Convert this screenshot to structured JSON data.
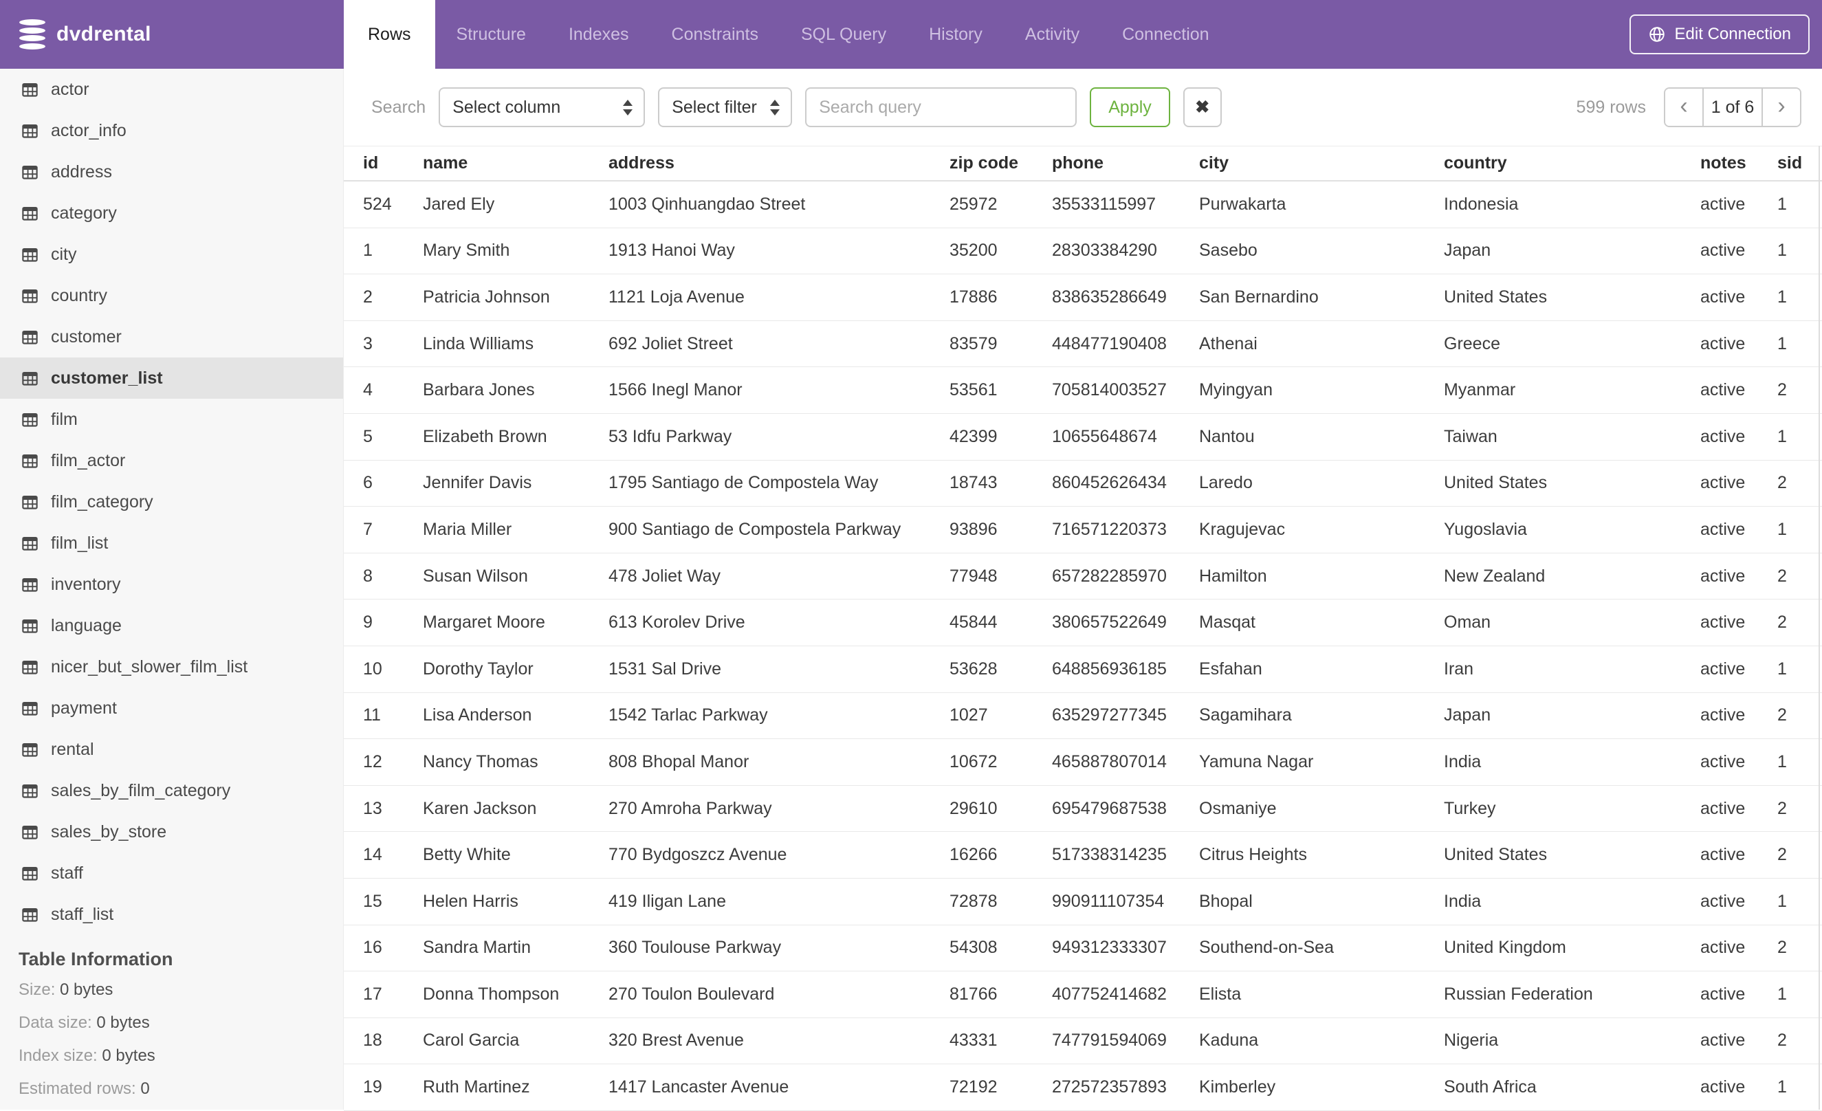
{
  "colors": {
    "header_purple": "#7a5aa5",
    "inactive_tab_text": "#cfc0e2",
    "apply_green": "#6db33f",
    "sidebar_bg": "#f7f7f7",
    "sidebar_selected_bg": "#e4e4e4"
  },
  "header": {
    "database_name": "dvdrental",
    "edit_connection_label": "Edit Connection"
  },
  "tabs": {
    "items": [
      {
        "label": "Rows",
        "active": true
      },
      {
        "label": "Structure",
        "active": false
      },
      {
        "label": "Indexes",
        "active": false
      },
      {
        "label": "Constraints",
        "active": false
      },
      {
        "label": "SQL Query",
        "active": false
      },
      {
        "label": "History",
        "active": false
      },
      {
        "label": "Activity",
        "active": false
      },
      {
        "label": "Connection",
        "active": false
      }
    ]
  },
  "search_bar": {
    "label": "Search",
    "column_select_value": "Select column",
    "filter_select_value": "Select filter",
    "query_placeholder": "Search query",
    "apply_label": "Apply",
    "clear_label": "✖",
    "row_count": "599 rows",
    "pagination": {
      "prev": "‹",
      "current": "1 of 6",
      "next": "›"
    }
  },
  "sidebar": {
    "tables": [
      "actor",
      "actor_info",
      "address",
      "category",
      "city",
      "country",
      "customer",
      "customer_list",
      "film",
      "film_actor",
      "film_category",
      "film_list",
      "inventory",
      "language",
      "nicer_but_slower_film_list",
      "payment",
      "rental",
      "sales_by_film_category",
      "sales_by_store",
      "staff",
      "staff_list"
    ],
    "selected": "customer_list",
    "table_information": {
      "heading": "Table Information",
      "stats": [
        {
          "label": "Size:",
          "value": "0 bytes"
        },
        {
          "label": "Data size:",
          "value": "0 bytes"
        },
        {
          "label": "Index size:",
          "value": "0 bytes"
        },
        {
          "label": "Estimated rows:",
          "value": "0"
        }
      ]
    }
  },
  "table": {
    "columns": [
      "id",
      "name",
      "address",
      "zip code",
      "phone",
      "city",
      "country",
      "notes",
      "sid"
    ],
    "rows": [
      [
        "524",
        "Jared Ely",
        "1003 Qinhuangdao Street",
        "25972",
        "35533115997",
        "Purwakarta",
        "Indonesia",
        "active",
        "1"
      ],
      [
        "1",
        "Mary Smith",
        "1913 Hanoi Way",
        "35200",
        "28303384290",
        "Sasebo",
        "Japan",
        "active",
        "1"
      ],
      [
        "2",
        "Patricia Johnson",
        "1121 Loja Avenue",
        "17886",
        "838635286649",
        "San Bernardino",
        "United States",
        "active",
        "1"
      ],
      [
        "3",
        "Linda Williams",
        "692 Joliet Street",
        "83579",
        "448477190408",
        "Athenai",
        "Greece",
        "active",
        "1"
      ],
      [
        "4",
        "Barbara Jones",
        "1566 Inegl Manor",
        "53561",
        "705814003527",
        "Myingyan",
        "Myanmar",
        "active",
        "2"
      ],
      [
        "5",
        "Elizabeth Brown",
        "53 Idfu Parkway",
        "42399",
        "10655648674",
        "Nantou",
        "Taiwan",
        "active",
        "1"
      ],
      [
        "6",
        "Jennifer Davis",
        "1795 Santiago de Compostela Way",
        "18743",
        "860452626434",
        "Laredo",
        "United States",
        "active",
        "2"
      ],
      [
        "7",
        "Maria Miller",
        "900 Santiago de Compostela Parkway",
        "93896",
        "716571220373",
        "Kragujevac",
        "Yugoslavia",
        "active",
        "1"
      ],
      [
        "8",
        "Susan Wilson",
        "478 Joliet Way",
        "77948",
        "657282285970",
        "Hamilton",
        "New Zealand",
        "active",
        "2"
      ],
      [
        "9",
        "Margaret Moore",
        "613 Korolev Drive",
        "45844",
        "380657522649",
        "Masqat",
        "Oman",
        "active",
        "2"
      ],
      [
        "10",
        "Dorothy Taylor",
        "1531 Sal Drive",
        "53628",
        "648856936185",
        "Esfahan",
        "Iran",
        "active",
        "1"
      ],
      [
        "11",
        "Lisa Anderson",
        "1542 Tarlac Parkway",
        "1027",
        "635297277345",
        "Sagamihara",
        "Japan",
        "active",
        "2"
      ],
      [
        "12",
        "Nancy Thomas",
        "808 Bhopal Manor",
        "10672",
        "465887807014",
        "Yamuna Nagar",
        "India",
        "active",
        "1"
      ],
      [
        "13",
        "Karen Jackson",
        "270 Amroha Parkway",
        "29610",
        "695479687538",
        "Osmaniye",
        "Turkey",
        "active",
        "2"
      ],
      [
        "14",
        "Betty White",
        "770 Bydgoszcz Avenue",
        "16266",
        "517338314235",
        "Citrus Heights",
        "United States",
        "active",
        "2"
      ],
      [
        "15",
        "Helen Harris",
        "419 Iligan Lane",
        "72878",
        "990911107354",
        "Bhopal",
        "India",
        "active",
        "1"
      ],
      [
        "16",
        "Sandra Martin",
        "360 Toulouse Parkway",
        "54308",
        "949312333307",
        "Southend-on-Sea",
        "United Kingdom",
        "active",
        "2"
      ],
      [
        "17",
        "Donna Thompson",
        "270 Toulon Boulevard",
        "81766",
        "407752414682",
        "Elista",
        "Russian Federation",
        "active",
        "1"
      ],
      [
        "18",
        "Carol Garcia",
        "320 Brest Avenue",
        "43331",
        "747791594069",
        "Kaduna",
        "Nigeria",
        "active",
        "2"
      ],
      [
        "19",
        "Ruth Martinez",
        "1417 Lancaster Avenue",
        "72192",
        "272572357893",
        "Kimberley",
        "South Africa",
        "active",
        "1"
      ]
    ]
  }
}
